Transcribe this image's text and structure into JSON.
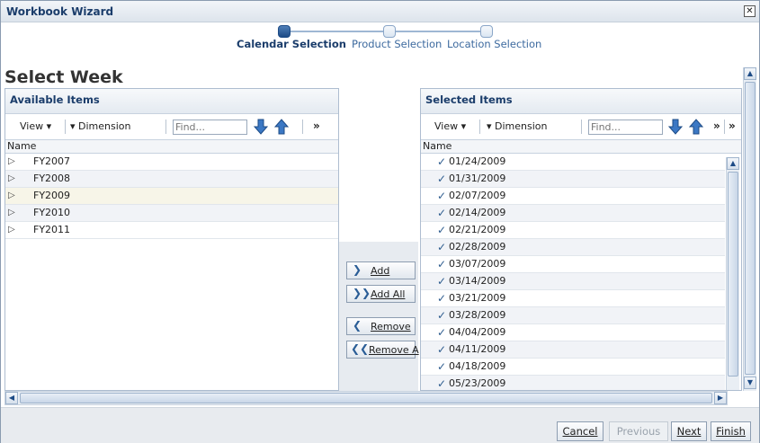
{
  "window": {
    "title": "Workbook Wizard"
  },
  "train": {
    "steps": [
      {
        "label": "Calendar Selection",
        "active": true
      },
      {
        "label": "Product Selection",
        "active": false
      },
      {
        "label": "Location Selection",
        "active": false
      }
    ]
  },
  "page": {
    "title": "Select Week"
  },
  "available": {
    "title": "Available Items",
    "toolbar": {
      "view": "View",
      "dimension": "Dimension",
      "find_placeholder": "Find..."
    },
    "column": "Name",
    "items": [
      "FY2007",
      "FY2008",
      "FY2009",
      "FY2010",
      "FY2011"
    ]
  },
  "selected": {
    "title": "Selected Items",
    "toolbar": {
      "view": "View",
      "dimension": "Dimension",
      "find_placeholder": "Find..."
    },
    "column": "Name",
    "items": [
      "01/24/2009",
      "01/31/2009",
      "02/07/2009",
      "02/14/2009",
      "02/21/2009",
      "02/28/2009",
      "03/07/2009",
      "03/14/2009",
      "03/21/2009",
      "03/28/2009",
      "04/04/2009",
      "04/11/2009",
      "04/18/2009",
      "05/23/2009"
    ]
  },
  "shuttle": {
    "add": "Add",
    "add_all": "Add All",
    "remove": "Remove",
    "remove_all": "Remove A"
  },
  "footer": {
    "cancel": "Cancel",
    "previous": "Previous",
    "next": "Next",
    "finish": "Finish"
  },
  "icons": {
    "close": "close-icon",
    "expand": "expand-triangle-icon",
    "check": "checkmark-icon",
    "move_down": "arrow-down-icon",
    "move_up": "arrow-up-icon",
    "overflow": "double-chevron-icon"
  },
  "colors": {
    "accent": "#1b3d6b",
    "link": "#3d6a9f",
    "button_icon": "#2a5d96"
  }
}
